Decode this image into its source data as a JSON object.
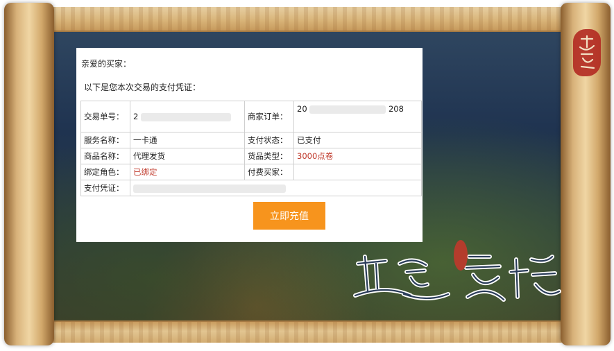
{
  "receipt": {
    "greeting": "亲爱的买家：",
    "subtitle": "以下是您本次交易的支付凭证：",
    "rows": [
      {
        "label1": "交易单号：",
        "value1": "2",
        "label2": "商家订单：",
        "value2_a": "20",
        "value2_b": "208"
      },
      {
        "label1": "服务名称：",
        "value1": "一卡通",
        "label2": "支付状态：",
        "value2": "已支付"
      },
      {
        "label1": "商品名称：",
        "value1": "代理发货",
        "label2": "货品类型：",
        "value2": "3000点卷"
      },
      {
        "label1": "绑定角色：",
        "value1": "已绑定",
        "label2": "付费买家：",
        "value2": ""
      },
      {
        "label1": "支付凭证：",
        "value1": ""
      }
    ],
    "button_label": "立即充值"
  },
  "colors": {
    "button": "#f7941d",
    "accent_red": "#c0392b"
  },
  "icons": {
    "seal": "red-seal-icon",
    "logo": "xiaoyao-kezhan-logo"
  }
}
